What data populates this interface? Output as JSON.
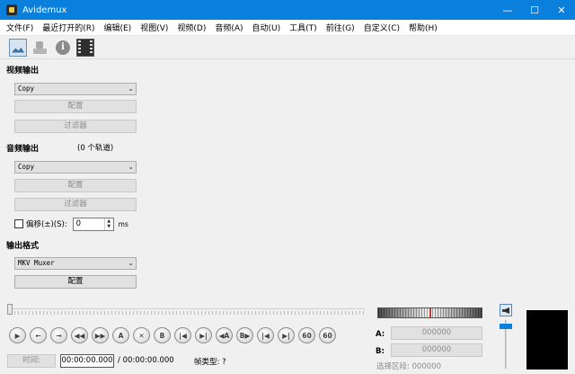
{
  "window": {
    "title": "Avidemux"
  },
  "menu": [
    "文件(F)",
    "最近打开的(R)",
    "编辑(E)",
    "视图(V)",
    "视频(D)",
    "音频(A)",
    "自动(U)",
    "工具(T)",
    "前往(G)",
    "自定义(C)",
    "帮助(H)"
  ],
  "toolbar_icons": [
    "open-image-icon",
    "save-icon",
    "info-icon",
    "film-icon"
  ],
  "video": {
    "heading": "视频输出",
    "codec": "Copy",
    "configure": "配置",
    "filters": "过滤器"
  },
  "audio": {
    "heading": "音频输出",
    "tracks": "(0 个轨道)",
    "codec": "Copy",
    "configure": "配置",
    "filters": "过滤器",
    "shift_label": "偏移(±)(S):",
    "shift_value": "0",
    "shift_unit": "ms"
  },
  "output": {
    "heading": "输出格式",
    "muxer": "MKV Muxer",
    "configure": "配置"
  },
  "playback": {
    "time_label": "时间:",
    "current_time": "00:00:00.000",
    "total_time": "/ 00:00:00.000",
    "frame_type": "帧类型: ?"
  },
  "markers": {
    "a_label": "A:",
    "a_value": "000000",
    "b_label": "B:",
    "b_value": "000000",
    "selection": "选择区段: 000000"
  },
  "colors": {
    "titlebar": "#0a7fdc",
    "preview": "#000000"
  }
}
